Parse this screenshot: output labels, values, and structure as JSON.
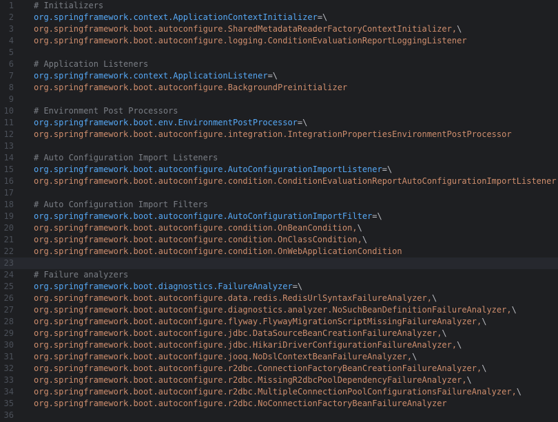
{
  "editor": {
    "current_line": 23,
    "lines": [
      {
        "n": "1",
        "type": "comment",
        "text": "# Initializers"
      },
      {
        "n": "2",
        "type": "key",
        "text": "org.springframework.context.ApplicationContextInitializer",
        "suffix": "=\\"
      },
      {
        "n": "3",
        "type": "value",
        "text": "org.springframework.boot.autoconfigure.SharedMetadataReaderFactoryContextInitializer,",
        "suffix": "\\"
      },
      {
        "n": "4",
        "type": "value",
        "text": "org.springframework.boot.autoconfigure.logging.ConditionEvaluationReportLoggingListener",
        "suffix": ""
      },
      {
        "n": "5",
        "type": "blank",
        "text": ""
      },
      {
        "n": "6",
        "type": "comment",
        "text": "# Application Listeners"
      },
      {
        "n": "7",
        "type": "key",
        "text": "org.springframework.context.ApplicationListener",
        "suffix": "=\\"
      },
      {
        "n": "8",
        "type": "value",
        "text": "org.springframework.boot.autoconfigure.BackgroundPreinitializer",
        "suffix": ""
      },
      {
        "n": "9",
        "type": "blank",
        "text": ""
      },
      {
        "n": "10",
        "type": "comment",
        "text": "# Environment Post Processors"
      },
      {
        "n": "11",
        "type": "key",
        "text": "org.springframework.boot.env.EnvironmentPostProcessor",
        "suffix": "=\\"
      },
      {
        "n": "12",
        "type": "value",
        "text": "org.springframework.boot.autoconfigure.integration.IntegrationPropertiesEnvironmentPostProcessor",
        "suffix": ""
      },
      {
        "n": "13",
        "type": "blank",
        "text": ""
      },
      {
        "n": "14",
        "type": "comment",
        "text": "# Auto Configuration Import Listeners"
      },
      {
        "n": "15",
        "type": "key",
        "text": "org.springframework.boot.autoconfigure.AutoConfigurationImportListener",
        "suffix": "=\\"
      },
      {
        "n": "16",
        "type": "value",
        "text": "org.springframework.boot.autoconfigure.condition.ConditionEvaluationReportAutoConfigurationImportListener",
        "suffix": ""
      },
      {
        "n": "17",
        "type": "blank",
        "text": ""
      },
      {
        "n": "18",
        "type": "comment",
        "text": "# Auto Configuration Import Filters"
      },
      {
        "n": "19",
        "type": "key",
        "text": "org.springframework.boot.autoconfigure.AutoConfigurationImportFilter",
        "suffix": "=\\"
      },
      {
        "n": "20",
        "type": "value",
        "text": "org.springframework.boot.autoconfigure.condition.OnBeanCondition,",
        "suffix": "\\"
      },
      {
        "n": "21",
        "type": "value",
        "text": "org.springframework.boot.autoconfigure.condition.OnClassCondition,",
        "suffix": "\\"
      },
      {
        "n": "22",
        "type": "value",
        "text": "org.springframework.boot.autoconfigure.condition.OnWebApplicationCondition",
        "suffix": ""
      },
      {
        "n": "23",
        "type": "blank",
        "text": ""
      },
      {
        "n": "24",
        "type": "comment",
        "text": "# Failure analyzers"
      },
      {
        "n": "25",
        "type": "key",
        "text": "org.springframework.boot.diagnostics.FailureAnalyzer",
        "suffix": "=\\"
      },
      {
        "n": "26",
        "type": "value",
        "text": "org.springframework.boot.autoconfigure.data.redis.RedisUrlSyntaxFailureAnalyzer,",
        "suffix": "\\"
      },
      {
        "n": "27",
        "type": "value",
        "text": "org.springframework.boot.autoconfigure.diagnostics.analyzer.NoSuchBeanDefinitionFailureAnalyzer,",
        "suffix": "\\"
      },
      {
        "n": "28",
        "type": "value",
        "text": "org.springframework.boot.autoconfigure.flyway.FlywayMigrationScriptMissingFailureAnalyzer,",
        "suffix": "\\"
      },
      {
        "n": "29",
        "type": "value",
        "text": "org.springframework.boot.autoconfigure.jdbc.DataSourceBeanCreationFailureAnalyzer,",
        "suffix": "\\"
      },
      {
        "n": "30",
        "type": "value",
        "text": "org.springframework.boot.autoconfigure.jdbc.HikariDriverConfigurationFailureAnalyzer,",
        "suffix": "\\"
      },
      {
        "n": "31",
        "type": "value",
        "text": "org.springframework.boot.autoconfigure.jooq.NoDslContextBeanFailureAnalyzer,",
        "suffix": "\\"
      },
      {
        "n": "32",
        "type": "value",
        "text": "org.springframework.boot.autoconfigure.r2dbc.ConnectionFactoryBeanCreationFailureAnalyzer,",
        "suffix": "\\"
      },
      {
        "n": "33",
        "type": "value",
        "text": "org.springframework.boot.autoconfigure.r2dbc.MissingR2dbcPoolDependencyFailureAnalyzer,",
        "suffix": "\\"
      },
      {
        "n": "34",
        "type": "value",
        "text": "org.springframework.boot.autoconfigure.r2dbc.MultipleConnectionPoolConfigurationsFailureAnalyzer,",
        "suffix": "\\"
      },
      {
        "n": "35",
        "type": "value",
        "text": "org.springframework.boot.autoconfigure.r2dbc.NoConnectionFactoryBeanFailureAnalyzer",
        "suffix": ""
      },
      {
        "n": "36",
        "type": "blank",
        "text": ""
      }
    ]
  },
  "colors": {
    "background": "#1e1f22",
    "current_line": "#26282e",
    "line_number": "#4b5059",
    "comment": "#7a7e85",
    "key": "#56a8f5",
    "value": "#cf8e6d",
    "punctuation": "#bcbec4"
  }
}
